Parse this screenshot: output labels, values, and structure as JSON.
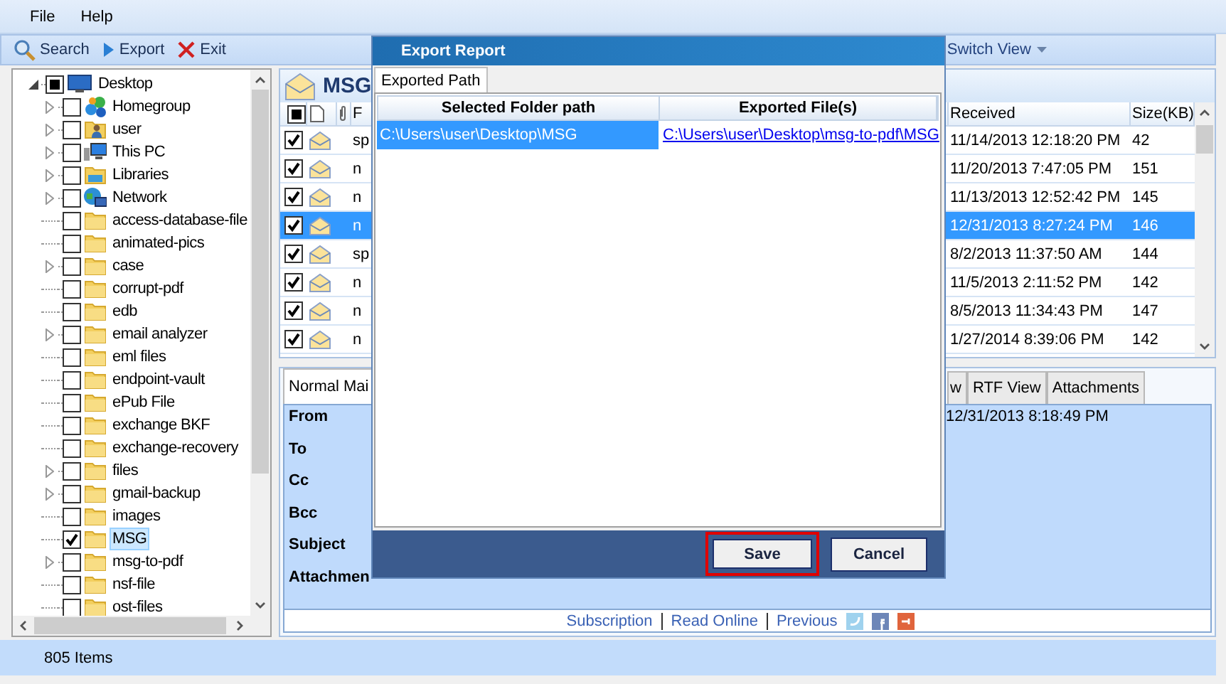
{
  "menu": [
    {
      "label": "File"
    },
    {
      "label": "Help"
    }
  ],
  "toolbar": {
    "buttons": [
      {
        "kind": "search",
        "label": "Search"
      },
      {
        "kind": "export",
        "label": "Export"
      },
      {
        "kind": "exit",
        "label": "Exit"
      }
    ],
    "switch_view": "Switch View"
  },
  "tree": {
    "label": "Desktop",
    "kind": "desktop",
    "checked": false,
    "indeterminate": true,
    "expanded": true,
    "selected": false,
    "children": [
      {
        "label": "Homegroup",
        "kind": "homegroup",
        "checked": false,
        "expandable": true,
        "selected": false
      },
      {
        "label": "user",
        "kind": "user",
        "checked": false,
        "expandable": true,
        "selected": false
      },
      {
        "label": "This PC",
        "kind": "pc",
        "checked": false,
        "expandable": true,
        "selected": false
      },
      {
        "label": "Libraries",
        "kind": "libraries",
        "checked": false,
        "expandable": true,
        "selected": false
      },
      {
        "label": "Network",
        "kind": "network",
        "checked": false,
        "expandable": true,
        "selected": false
      },
      {
        "label": "access-database-file",
        "kind": "folder",
        "checked": false,
        "expandable": false,
        "selected": false
      },
      {
        "label": "animated-pics",
        "kind": "folder",
        "checked": false,
        "expandable": false,
        "selected": false
      },
      {
        "label": "case",
        "kind": "folder",
        "checked": false,
        "expandable": true,
        "selected": false
      },
      {
        "label": "corrupt-pdf",
        "kind": "folder",
        "checked": false,
        "expandable": false,
        "selected": false
      },
      {
        "label": "edb",
        "kind": "folder",
        "checked": false,
        "expandable": false,
        "selected": false
      },
      {
        "label": "email analyzer",
        "kind": "folder",
        "checked": false,
        "expandable": true,
        "selected": false
      },
      {
        "label": "eml files",
        "kind": "folder",
        "checked": false,
        "expandable": false,
        "selected": false
      },
      {
        "label": "endpoint-vault",
        "kind": "folder",
        "checked": false,
        "expandable": false,
        "selected": false
      },
      {
        "label": "ePub File",
        "kind": "folder",
        "checked": false,
        "expandable": false,
        "selected": false
      },
      {
        "label": "exchange BKF",
        "kind": "folder",
        "checked": false,
        "expandable": false,
        "selected": false
      },
      {
        "label": "exchange-recovery",
        "kind": "folder",
        "checked": false,
        "expandable": false,
        "selected": false
      },
      {
        "label": "files",
        "kind": "folder",
        "checked": false,
        "expandable": true,
        "selected": false
      },
      {
        "label": "gmail-backup",
        "kind": "folder",
        "checked": false,
        "expandable": true,
        "selected": false
      },
      {
        "label": "images",
        "kind": "folder",
        "checked": false,
        "expandable": false,
        "selected": false
      },
      {
        "label": "MSG",
        "kind": "folder",
        "checked": true,
        "expandable": false,
        "selected": true
      },
      {
        "label": "msg-to-pdf",
        "kind": "folder",
        "checked": false,
        "expandable": true,
        "selected": false
      },
      {
        "label": "nsf-file",
        "kind": "folder",
        "checked": false,
        "expandable": false,
        "selected": false
      },
      {
        "label": "ost-files",
        "kind": "folder",
        "checked": false,
        "expandable": false,
        "selected": false
      }
    ]
  },
  "message_list": {
    "title": "MSG",
    "select_all": {
      "checked": false,
      "indeterminate": true
    },
    "columns": [
      "F",
      "Received",
      "Size(KB)"
    ],
    "rows": [
      {
        "checked": true,
        "selected": false,
        "column_4": "sp",
        "received": "11/14/2013 12:18:20 PM",
        "size": "42"
      },
      {
        "checked": true,
        "selected": false,
        "column_4": "n",
        "received": "11/20/2013 7:47:05 PM",
        "size": "151"
      },
      {
        "checked": true,
        "selected": false,
        "column_4": "n",
        "received": "11/13/2013 12:52:42 PM",
        "size": "145"
      },
      {
        "checked": true,
        "selected": true,
        "column_4": "n",
        "received": "12/31/2013 8:27:24 PM",
        "size": "146"
      },
      {
        "checked": true,
        "selected": false,
        "column_4": "sp",
        "received": "8/2/2013 11:37:50 AM",
        "size": "144"
      },
      {
        "checked": true,
        "selected": false,
        "column_4": "n",
        "received": "11/5/2013 2:11:52 PM",
        "size": "142"
      },
      {
        "checked": true,
        "selected": false,
        "column_4": "n",
        "received": "8/5/2013 11:34:43 PM",
        "size": "147"
      },
      {
        "checked": true,
        "selected": false,
        "column_4": "n",
        "received": "1/27/2014 8:39:06 PM",
        "size": "142"
      }
    ]
  },
  "preview": {
    "tabs": [
      {
        "label": "Normal Mai",
        "selected": true
      },
      {
        "label": "w",
        "selected": false
      },
      {
        "label": "RTF View",
        "selected": false
      },
      {
        "label": "Attachments",
        "selected": false
      }
    ],
    "fields": [
      {
        "label": "From",
        "value": "12/31/2013 8:18:49 PM"
      },
      {
        "label": "To"
      },
      {
        "label": "Cc"
      },
      {
        "label": "Bcc"
      },
      {
        "label": "Subject"
      },
      {
        "label": "Attachmen"
      }
    ],
    "links": [
      "Subscription",
      "Read Online",
      "Previous"
    ]
  },
  "status_bar": {
    "text": "805 Items"
  },
  "dialog": {
    "title": "Export Report",
    "tabs": [
      {
        "label": "Exported Path",
        "selected": true
      }
    ],
    "columns": [
      "Selected Folder path",
      "Exported File(s)"
    ],
    "rows": [
      {
        "selected": true,
        "folder": "C:\\Users\\user\\Desktop\\MSG",
        "exported_file": "C:\\Users\\user\\Desktop\\msg-to-pdf\\MSG"
      }
    ],
    "buttons": [
      {
        "label": "Save",
        "focused": true
      },
      {
        "label": "Cancel",
        "focused": false
      }
    ]
  }
}
